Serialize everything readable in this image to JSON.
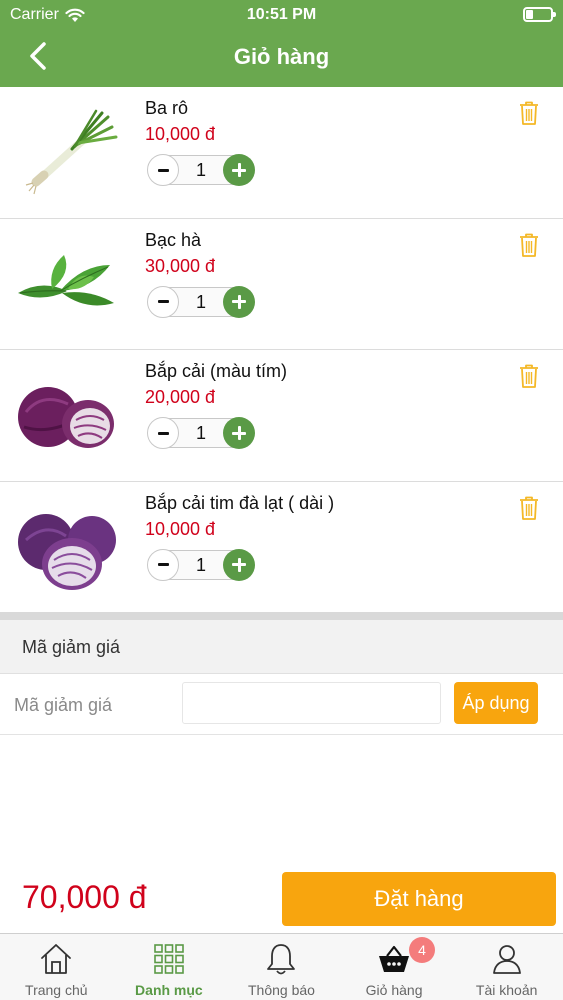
{
  "status_bar": {
    "carrier": "Carrier",
    "time": "10:51 PM"
  },
  "nav": {
    "title": "Giỏ hàng"
  },
  "cart": {
    "items": [
      {
        "name": "Ba rô",
        "price": "10,000 đ",
        "quantity": "1",
        "image": "leek"
      },
      {
        "name": "Bạc hà",
        "price": "30,000 đ",
        "quantity": "1",
        "image": "mint"
      },
      {
        "name": "Bắp cải (màu tím)",
        "price": "20,000 đ",
        "quantity": "1",
        "image": "red-cabbage"
      },
      {
        "name": "Bắp cải tim đà lạt ( dài )",
        "price": "10,000 đ",
        "quantity": "1",
        "image": "red-cabbage-long"
      }
    ]
  },
  "coupon": {
    "section_title": "Mã giảm giá",
    "label": "Mã giảm giá",
    "value": "",
    "placeholder": "",
    "apply_label": "Áp dụng"
  },
  "checkout": {
    "total": "70,000 đ",
    "order_label": "Đặt hàng"
  },
  "tabbar": {
    "active": "Danh mục",
    "cart_badge": "4",
    "items": [
      {
        "label": "Trang chủ",
        "icon": "home-icon"
      },
      {
        "label": "Danh mục",
        "icon": "grid-icon"
      },
      {
        "label": "Thông báo",
        "icon": "bell-icon"
      },
      {
        "label": "Giỏ hàng",
        "icon": "basket-icon"
      },
      {
        "label": "Tài khoản",
        "icon": "user-icon"
      }
    ]
  },
  "colors": {
    "primary_green": "#6aa84f",
    "accent_orange": "#f8a50e",
    "price_red": "#d0021b",
    "badge_pink": "#f47c7c"
  }
}
